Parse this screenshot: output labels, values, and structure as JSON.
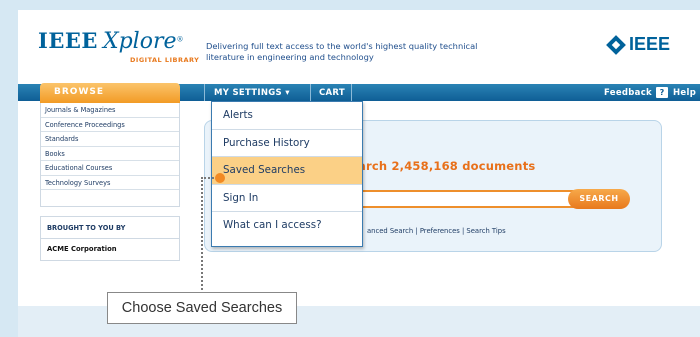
{
  "header": {
    "logo_ieee": "IEEE",
    "logo_xplore": "Xplore",
    "logo_reg": "®",
    "logo_sub": "DIGITAL LIBRARY",
    "tagline": "Delivering full text access to the world's highest quality technical literature in engineering and technology",
    "brand_logo": "IEEE"
  },
  "nav": {
    "browse": "BROWSE",
    "my_settings": "MY SETTINGS ▾",
    "cart": "CART",
    "feedback": "Feedback",
    "help_icon": "?",
    "help": "Help"
  },
  "sidebar": {
    "items": [
      {
        "label": "Journals & Magazines"
      },
      {
        "label": "Conference Proceedings"
      },
      {
        "label": "Standards"
      },
      {
        "label": "Books"
      },
      {
        "label": "Educational Courses"
      },
      {
        "label": "Technology Surveys"
      }
    ],
    "brought_heading": "BROUGHT TO YOU BY",
    "brought_org": "ACME Corporation"
  },
  "search": {
    "title_partial": "arch 2,458,168 documents",
    "button": "SEARCH",
    "links": "anced Search  |  Preferences |  Search Tips",
    "query": ""
  },
  "dropdown": {
    "items": [
      {
        "label": "Alerts"
      },
      {
        "label": "Purchase History"
      },
      {
        "label": "Saved Searches"
      },
      {
        "label": "Sign In"
      },
      {
        "label": "What can I access?"
      }
    ],
    "active_index": 2
  },
  "callout": {
    "text": "Choose Saved Searches"
  },
  "colors": {
    "brand_blue": "#00629b",
    "accent_orange": "#e8791d",
    "highlight": "#fbd086"
  }
}
